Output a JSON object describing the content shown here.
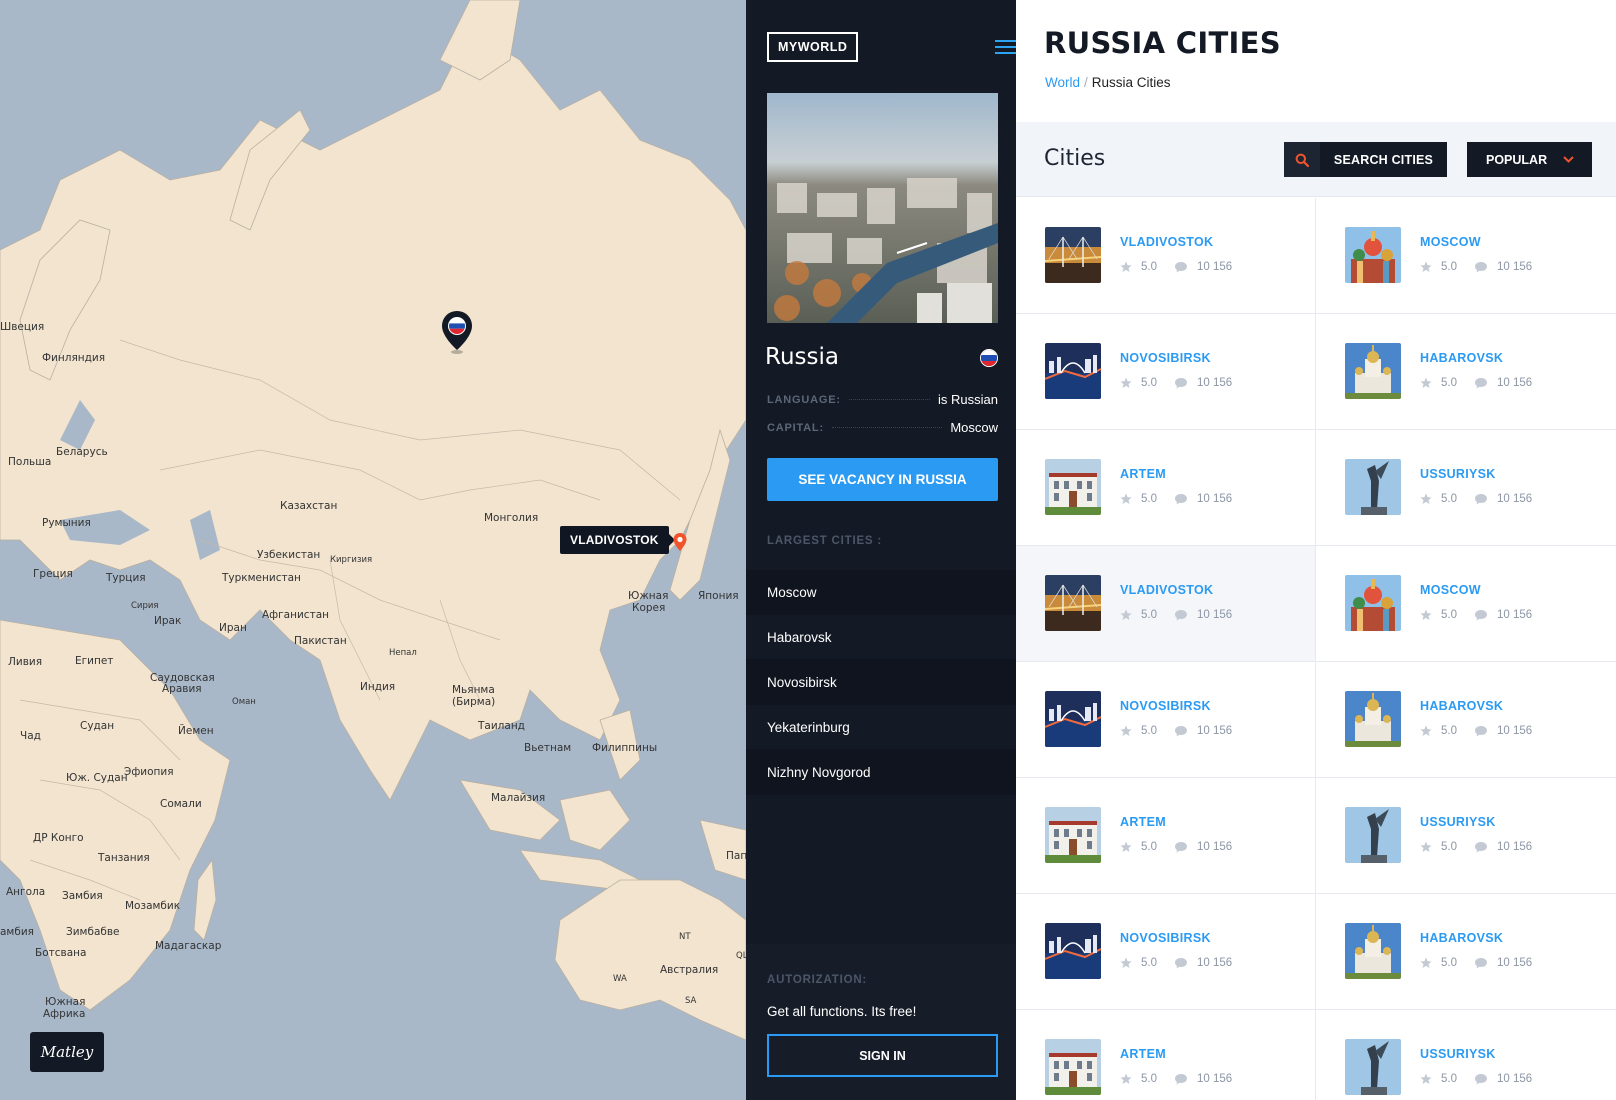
{
  "map": {
    "labels": [
      {
        "text": "Швеция",
        "cls": ""
      },
      {
        "text": "Финляндия",
        "cls": ""
      },
      {
        "text": "Беларусь",
        "cls": ""
      },
      {
        "text": "Польша",
        "cls": ""
      },
      {
        "text": "Румыния",
        "cls": ""
      },
      {
        "text": "Казахстан",
        "cls": ""
      },
      {
        "text": "Монголия",
        "cls": ""
      },
      {
        "text": "Узбекистан",
        "cls": ""
      },
      {
        "text": "Киргизия",
        "cls": "small"
      },
      {
        "text": "Туркменистан",
        "cls": ""
      },
      {
        "text": "Греция",
        "cls": ""
      },
      {
        "text": "Турция",
        "cls": ""
      },
      {
        "text": "Сирия",
        "cls": "small"
      },
      {
        "text": "Ирак",
        "cls": ""
      },
      {
        "text": "Иран",
        "cls": ""
      },
      {
        "text": "Афганистан",
        "cls": ""
      },
      {
        "text": "Пакистан",
        "cls": ""
      },
      {
        "text": "Непал",
        "cls": "small"
      },
      {
        "text": "Южная",
        "cls": ""
      },
      {
        "text": "Корея",
        "cls": ""
      },
      {
        "text": "Япония",
        "cls": ""
      },
      {
        "text": "Ливия",
        "cls": ""
      },
      {
        "text": "Египет",
        "cls": ""
      },
      {
        "text": "Саудовская",
        "cls": ""
      },
      {
        "text": "Аравия",
        "cls": ""
      },
      {
        "text": "Оман",
        "cls": "small"
      },
      {
        "text": "Индия",
        "cls": ""
      },
      {
        "text": "Мьянма",
        "cls": ""
      },
      {
        "text": "(Бирма)",
        "cls": ""
      },
      {
        "text": "Таиланд",
        "cls": ""
      },
      {
        "text": "Вьетнам",
        "cls": ""
      },
      {
        "text": "Филиппины",
        "cls": ""
      },
      {
        "text": "Чад",
        "cls": ""
      },
      {
        "text": "Судан",
        "cls": ""
      },
      {
        "text": "Йемен",
        "cls": ""
      },
      {
        "text": "Эфиопия",
        "cls": ""
      },
      {
        "text": "Юж. Судан",
        "cls": ""
      },
      {
        "text": "Сомали",
        "cls": ""
      },
      {
        "text": "Малайзия",
        "cls": ""
      },
      {
        "text": "ДР Конго",
        "cls": ""
      },
      {
        "text": "Танзания",
        "cls": ""
      },
      {
        "text": "Ангола",
        "cls": ""
      },
      {
        "text": "Замбия",
        "cls": ""
      },
      {
        "text": "Мозамбик",
        "cls": ""
      },
      {
        "text": "амбия",
        "cls": ""
      },
      {
        "text": "Зимбабве",
        "cls": ""
      },
      {
        "text": "Ботсвана",
        "cls": ""
      },
      {
        "text": "Мадагаскар",
        "cls": ""
      },
      {
        "text": "Южная",
        "cls": ""
      },
      {
        "text": "Африка",
        "cls": ""
      },
      {
        "text": "NT",
        "cls": "small"
      },
      {
        "text": "Австралия",
        "cls": ""
      },
      {
        "text": "WA",
        "cls": "small"
      },
      {
        "text": "SA",
        "cls": "small"
      },
      {
        "text": "Пап",
        "cls": ""
      },
      {
        "text": "QL",
        "cls": "small"
      }
    ],
    "tooltip": "VLADIVOSTOK",
    "badge": "Matley"
  },
  "sidebar": {
    "brand": "MYWORLD",
    "country": "Russia",
    "language_key": "LANGUAGE:",
    "language_val": "is Russian",
    "capital_key": "CAPITAL:",
    "capital_val": "Moscow",
    "cta": "SEE VACANCY IN RUSSIA",
    "largest_title": "LARGEST CITIES :",
    "largest": [
      "Moscow",
      "Habarovsk",
      "Novosibirsk",
      "Yekaterinburg",
      "Nizhny Novgorod"
    ],
    "auth_title": "AUTORIZATION:",
    "auth_text": "Get all functions. Its free!",
    "signin": "SIGN IN",
    "flag_colors": [
      "#ffffff",
      "#1f4fb3",
      "#e0262f"
    ]
  },
  "content": {
    "title": "RUSSIA CITIES",
    "breadcrumb": {
      "root": "World",
      "sep": "/",
      "current": "Russia Cities"
    },
    "section": "Cities",
    "search_label": "SEARCH CITIES",
    "sort_label": "POPULAR",
    "rows": [
      [
        {
          "name": "VLADIVOSTOK",
          "rating": "5.0",
          "comments": "10 156",
          "img": "bridge"
        },
        {
          "name": "MOSCOW",
          "rating": "5.0",
          "comments": "10 156",
          "img": "cathedral"
        }
      ],
      [
        {
          "name": "NOVOSIBIRSK",
          "rating": "5.0",
          "comments": "10 156",
          "img": "night"
        },
        {
          "name": "HABAROVSK",
          "rating": "5.0",
          "comments": "10 156",
          "img": "church"
        }
      ],
      [
        {
          "name": "ARTEM",
          "rating": "5.0",
          "comments": "10 156",
          "img": "building"
        },
        {
          "name": "USSURIYSK",
          "rating": "5.0",
          "comments": "10 156",
          "img": "statue"
        }
      ],
      [
        {
          "name": "VLADIVOSTOK",
          "rating": "5.0",
          "comments": "10 156",
          "img": "bridge"
        },
        {
          "name": "MOSCOW",
          "rating": "5.0",
          "comments": "10 156",
          "img": "cathedral"
        }
      ],
      [
        {
          "name": "NOVOSIBIRSK",
          "rating": "5.0",
          "comments": "10 156",
          "img": "night"
        },
        {
          "name": "HABAROVSK",
          "rating": "5.0",
          "comments": "10 156",
          "img": "church"
        }
      ],
      [
        {
          "name": "ARTEM",
          "rating": "5.0",
          "comments": "10 156",
          "img": "building"
        },
        {
          "name": "USSURIYSK",
          "rating": "5.0",
          "comments": "10 156",
          "img": "statue"
        }
      ],
      [
        {
          "name": "NOVOSIBIRSK",
          "rating": "5.0",
          "comments": "10 156",
          "img": "night"
        },
        {
          "name": "HABAROVSK",
          "rating": "5.0",
          "comments": "10 156",
          "img": "church"
        }
      ],
      [
        {
          "name": "ARTEM",
          "rating": "5.0",
          "comments": "10 156",
          "img": "building"
        },
        {
          "name": "USSURIYSK",
          "rating": "5.0",
          "comments": "10 156",
          "img": "statue"
        }
      ]
    ],
    "highlighted_row": 3
  },
  "colors": {
    "accent": "#2b9af3",
    "dark": "#131a25",
    "pin_orange": "#f0542d"
  }
}
